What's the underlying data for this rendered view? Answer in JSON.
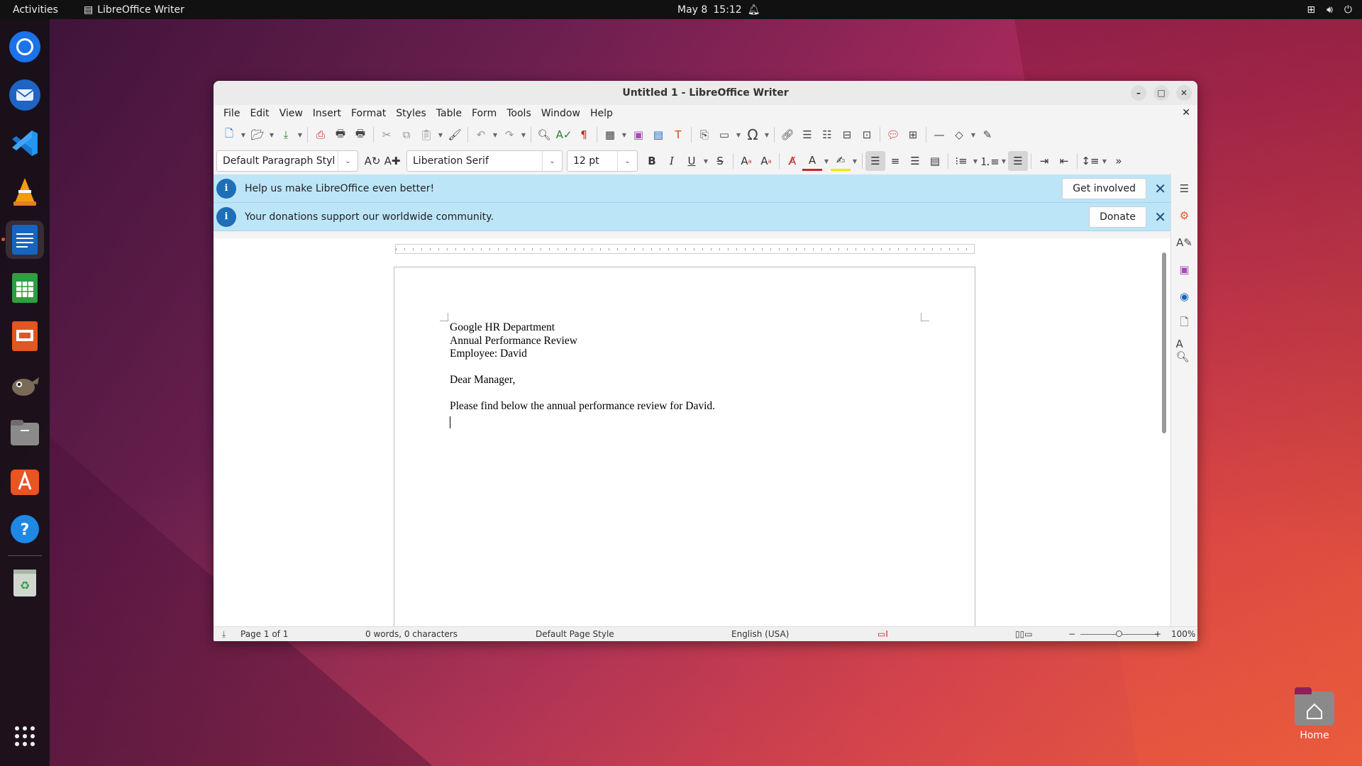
{
  "topbar": {
    "activities": "Activities",
    "app_name": "LibreOffice Writer",
    "date": "May 8",
    "time": "15:12"
  },
  "desktop": {
    "home_label": "Home"
  },
  "window": {
    "title": "Untitled 1 - LibreOffice Writer"
  },
  "menu": [
    "File",
    "Edit",
    "View",
    "Insert",
    "Format",
    "Styles",
    "Table",
    "Form",
    "Tools",
    "Window",
    "Help"
  ],
  "format": {
    "paragraph_style": "Default Paragraph Styl",
    "font_name": "Liberation Serif",
    "font_size": "12 pt"
  },
  "infobars": [
    {
      "message": "Help us make LibreOffice even better!",
      "button": "Get involved"
    },
    {
      "message": "Your donations support our worldwide community.",
      "button": "Donate"
    }
  ],
  "document": {
    "lines": [
      "Google HR Department",
      "Annual Performance Review",
      "Employee: David",
      "",
      "Dear Manager,",
      "",
      "Please find below the annual performance review for David.",
      ""
    ]
  },
  "status": {
    "page": "Page 1 of 1",
    "words": "0 words, 0 characters",
    "page_style": "Default Page Style",
    "language": "English (USA)",
    "zoom": "100%"
  },
  "colors": {
    "accent": "#e95420",
    "infobar": "#bde5f8",
    "info_icon": "#1e6fb5"
  }
}
